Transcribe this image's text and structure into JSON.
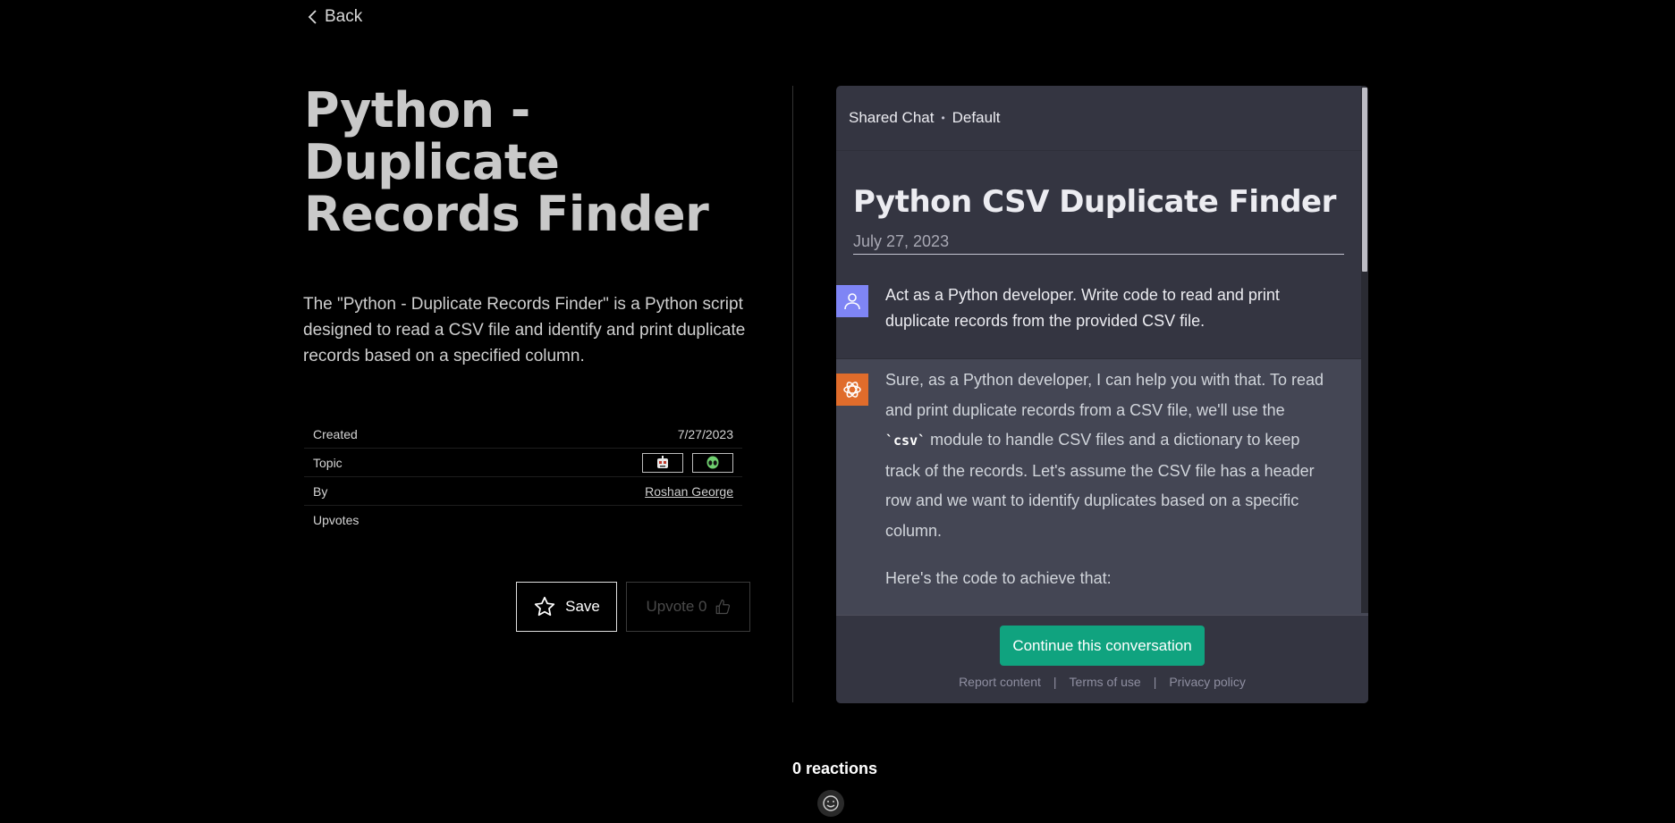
{
  "nav": {
    "back_label": "Back"
  },
  "page": {
    "title": "Python - Duplicate Records Finder",
    "description": "The \"Python - Duplicate Records Finder\" is a Python script designed to read a CSV file and identify and print duplicate records based on a specified column."
  },
  "meta": {
    "created_label": "Created",
    "created_value": "7/27/2023",
    "topic_label": "Topic",
    "topics": [
      "robot-face-icon",
      "alien-face-icon"
    ],
    "by_label": "By",
    "by_value": "Roshan George",
    "upvotes_label": "Upvotes",
    "upvotes_value": ""
  },
  "actions": {
    "save_label": "Save",
    "upvote_label": "Upvote 0"
  },
  "chat": {
    "header_left": "Shared Chat",
    "header_sep": "•",
    "header_right": "Default",
    "title": "Python CSV Duplicate Finder",
    "date": "July 27, 2023",
    "user_message": "Act as a Python developer. Write code to read and print duplicate records from the provided CSV file.",
    "bot_part1": "Sure, as a Python developer, I can help you with that. To read and print duplicate records from a CSV file, we'll use the ",
    "bot_code": "`csv`",
    "bot_part2": " module to handle CSV files and a dictionary to keep track of the records. Let's assume the CSV file has a header row and we want to identify duplicates based on a specific column.",
    "bot_para2": "Here's the code to achieve that:",
    "continue_label": "Continue this conversation",
    "footer_links": [
      "Report content",
      "Terms of use",
      "Privacy policy"
    ],
    "footer_sep": "|"
  },
  "reactions": {
    "label": "0 reactions"
  },
  "colors": {
    "background": "#000000",
    "chat_bg": "#343541",
    "bot_bg": "#444654",
    "user_avatar": "#7f85f5",
    "bot_avatar": "#e06c2b",
    "continue_btn": "#10a37f"
  }
}
